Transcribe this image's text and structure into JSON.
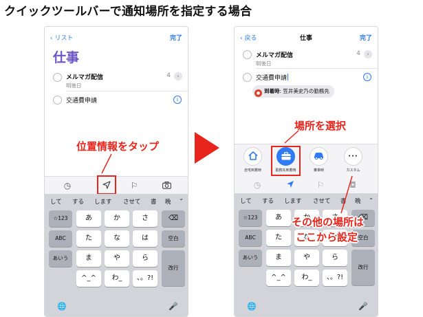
{
  "heading": "クイックツールバーで通知場所を指定する場合",
  "colors": {
    "accent": "#e8251c",
    "ios_blue": "#2f7bf5",
    "list_title": "#6a55c8",
    "pin": "#d9432f"
  },
  "left_phone": {
    "nav": {
      "back": "リスト",
      "done": "完了"
    },
    "list_title": "仕事",
    "items": [
      {
        "title": "メルマガ配信",
        "subtitle": "明後日",
        "count": "4"
      },
      {
        "title": "交通費申請"
      }
    ],
    "toolbar_icons": [
      "clock-icon",
      "location-arrow-icon",
      "flag-icon",
      "camera-icon"
    ],
    "callout": "位置情報をタップ"
  },
  "right_phone": {
    "nav": {
      "back": "戻る",
      "title": "仕事",
      "done": "完了"
    },
    "items": [
      {
        "title": "メルマガ配信",
        "subtitle": "明後日",
        "count": "4"
      },
      {
        "title": "交通費申請"
      }
    ],
    "location_pill": {
      "label": "到着時",
      "value": ": 笠井美史乃の勤務先"
    },
    "quick_actions": [
      {
        "icon": "home-icon",
        "label": "自宅到着時"
      },
      {
        "icon": "briefcase-icon",
        "label": "勤務先到着時",
        "selected": true
      },
      {
        "icon": "car-icon",
        "label": "乗車時"
      },
      {
        "icon": "more-icon",
        "label": "カスタム"
      }
    ],
    "callout_top": "場所を選択",
    "callout_bottom_1": "その他の場所は",
    "callout_bottom_2": "ここから設定"
  },
  "keyboard": {
    "suggestions": [
      "して",
      "する",
      "します",
      "させて",
      "書",
      "晩"
    ],
    "chevron": "⌄",
    "row1": [
      "☆123",
      "あ",
      "か",
      "さ",
      "⌫"
    ],
    "row2": [
      "ABC",
      "た",
      "な",
      "は",
      "空白"
    ],
    "row3": [
      "あいう",
      "ま",
      "や",
      "ら",
      "改行"
    ],
    "row4": [
      "^_^",
      "わ_",
      "、。?!"
    ],
    "globe": "🌐",
    "mic": "🎤"
  }
}
